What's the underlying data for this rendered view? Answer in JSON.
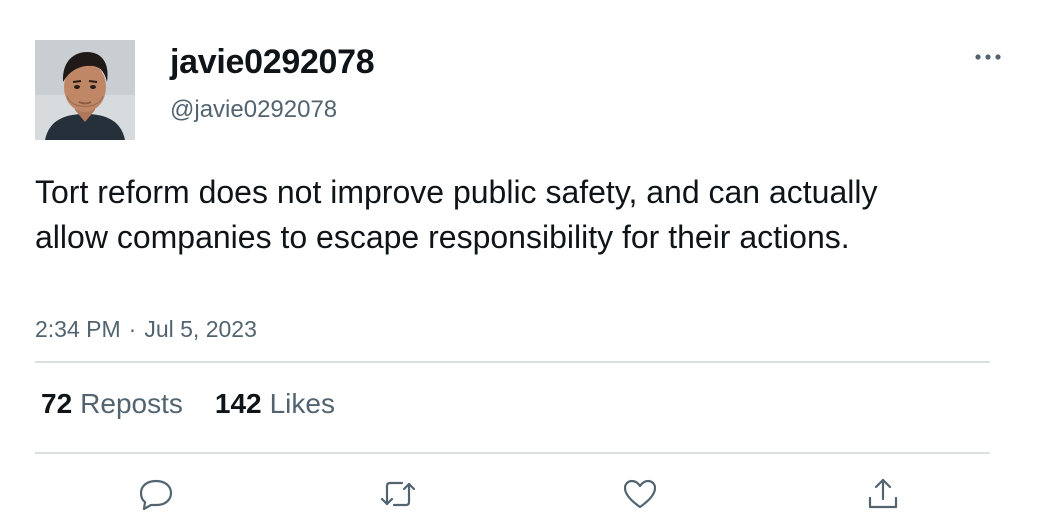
{
  "user": {
    "display_name": "javie0292078",
    "handle": "@javie0292078"
  },
  "tweet": {
    "text": "Tort reform does not improve public safety, and can actually allow companies to escape responsibility for their actions.",
    "time": "2:34 PM",
    "separator": "·",
    "date": "Jul 5, 2023"
  },
  "stats": {
    "reposts_count": "72",
    "reposts_label": "Reposts",
    "likes_count": "142",
    "likes_label": "Likes"
  },
  "icons": {
    "more": "more-horizontal-icon",
    "reply": "reply-icon",
    "repost": "repost-icon",
    "like": "heart-icon",
    "share": "share-icon"
  },
  "colors": {
    "text_primary": "#0f1419",
    "text_secondary": "#536471",
    "divider": "#dcdfe2"
  }
}
